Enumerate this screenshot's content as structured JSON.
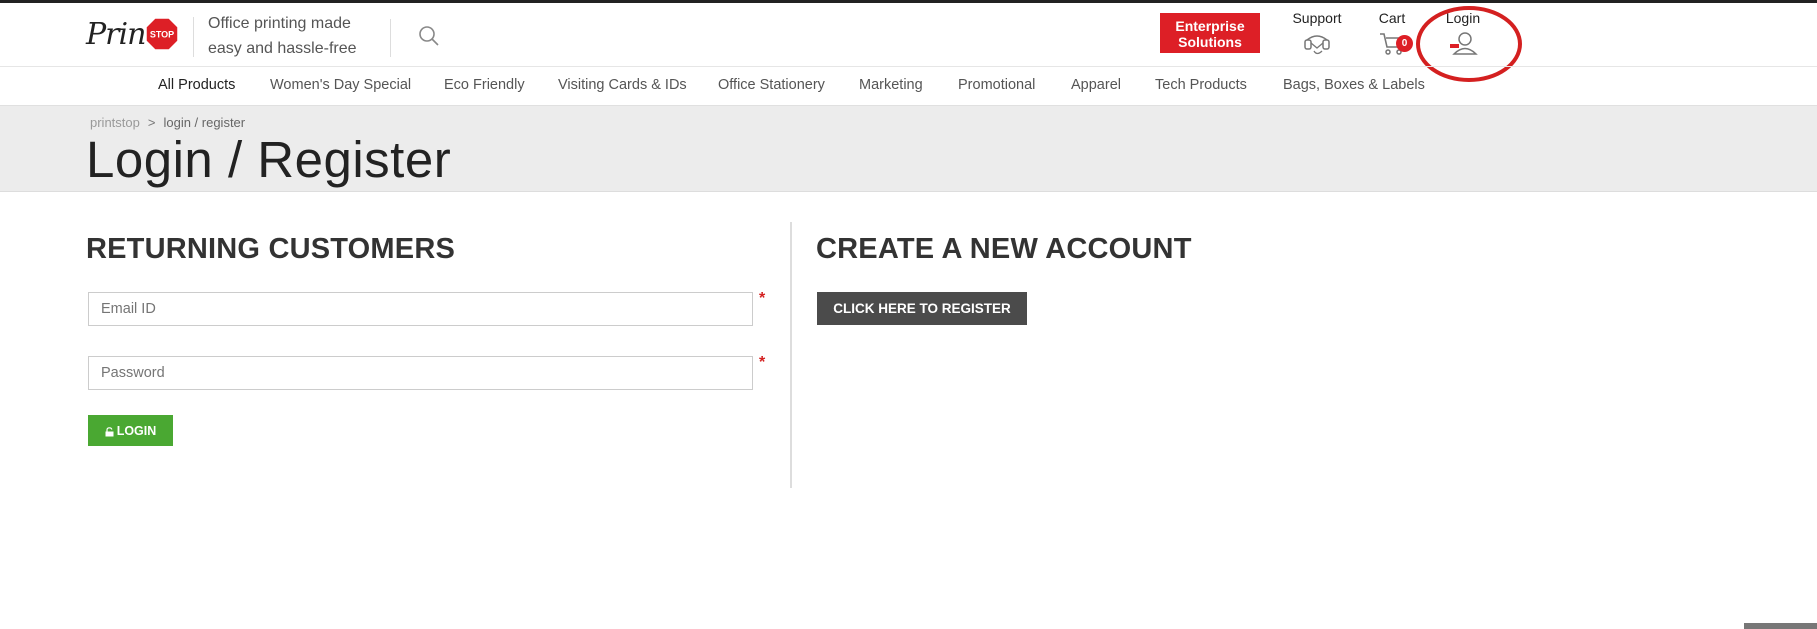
{
  "header": {
    "logo_text": "Print",
    "logo_stop": "STOP",
    "tagline_line1": "Office printing made",
    "tagline_line2": "easy and hassle-free",
    "enterprise_line1": "Enterprise",
    "enterprise_line2": "Solutions",
    "support_label": "Support",
    "cart_label": "Cart",
    "cart_count": "0",
    "login_label": "Login",
    "icons": [
      "search-icon",
      "support-icon",
      "cart-icon",
      "user-icon"
    ]
  },
  "nav": {
    "items": [
      "All Products",
      "Women's Day Special",
      "Eco Friendly",
      "Visiting Cards & IDs",
      "Office Stationery",
      "Marketing",
      "Promotional",
      "Apparel",
      "Tech Products",
      "Bags, Boxes & Labels"
    ]
  },
  "breadcrumb": {
    "home": "printstop",
    "separator": ">",
    "current": "login / register"
  },
  "page": {
    "title": "Login / Register"
  },
  "returning": {
    "title": "RETURNING CUSTOMERS",
    "email_placeholder": "Email ID",
    "password_placeholder": "Password",
    "required_mark": "*",
    "login_button": "LOGIN"
  },
  "create": {
    "title": "CREATE A NEW ACCOUNT",
    "register_button": "CLICK HERE TO REGISTER"
  },
  "colors": {
    "brand_red": "#dd1f26",
    "login_green": "#4aa832",
    "register_dark": "#4b4b4b",
    "annotation_circle": "#d42020"
  }
}
